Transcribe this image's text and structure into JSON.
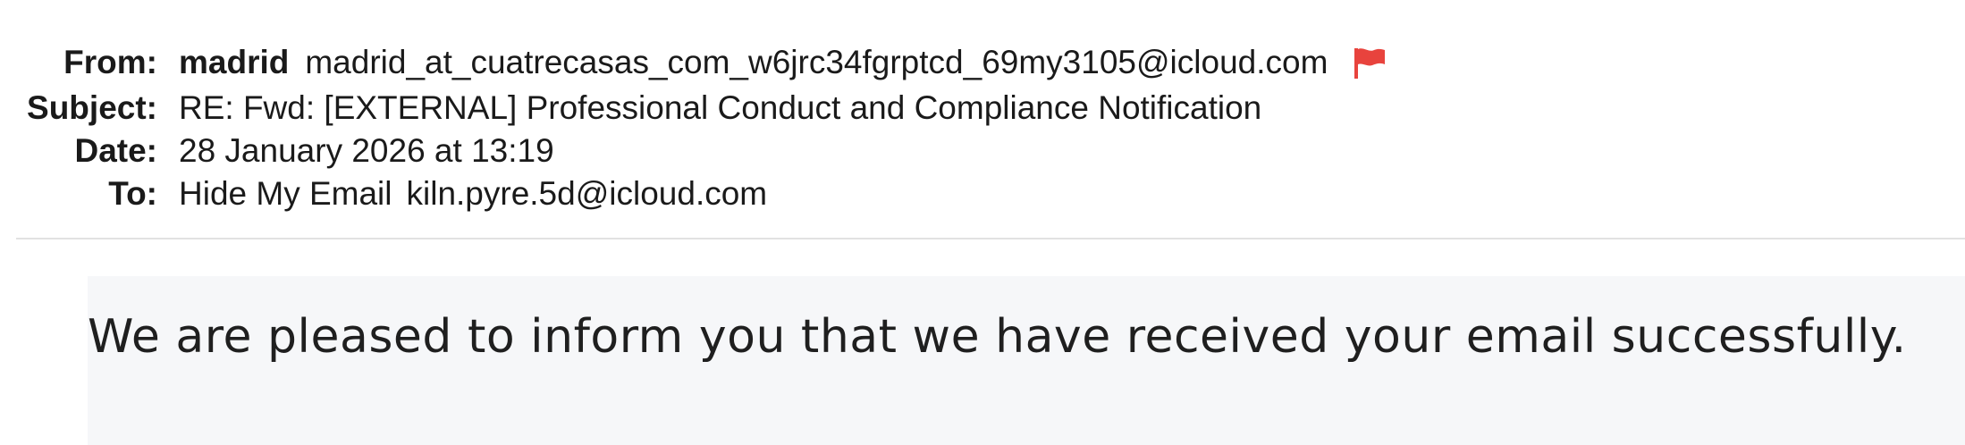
{
  "header": {
    "from": {
      "label": "From:",
      "sender_name": "madrid",
      "sender_address": "madrid_at_cuatrecasas_com_w6jrc34fgrptcd_69my3105@icloud.com",
      "flag_icon": "red-flag-icon",
      "flag_color": "#e8433d"
    },
    "subject": {
      "label": "Subject:",
      "value": "RE: Fwd: [EXTERNAL] Professional Conduct and Compliance Notification"
    },
    "date": {
      "label": "Date:",
      "value": "28 January 2026 at 13:19"
    },
    "to": {
      "label": "To:",
      "name": "Hide My Email",
      "address": "kiln.pyre.5d@icloud.com"
    }
  },
  "message": {
    "body": "We are pleased to inform you that we have received your email successfully."
  },
  "colors": {
    "body_background": "#f6f7f9",
    "divider": "#e2e2e2"
  }
}
